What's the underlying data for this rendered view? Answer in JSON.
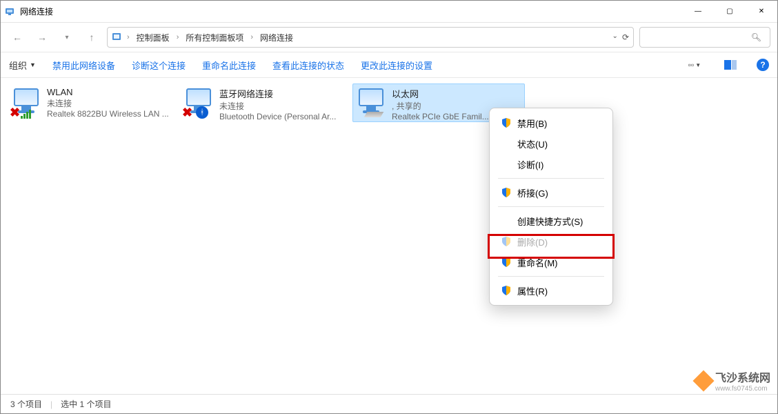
{
  "window": {
    "title": "网络连接"
  },
  "breadcrumbs": {
    "root": "控制面板",
    "all": "所有控制面板项",
    "here": "网络连接"
  },
  "toolbar": {
    "organize": "组织",
    "disable": "禁用此网络设备",
    "diagnose": "诊断这个连接",
    "rename": "重命名此连接",
    "view_status": "查看此连接的状态",
    "change_settings": "更改此连接的设置"
  },
  "items": [
    {
      "name": "WLAN",
      "status": "未连接",
      "device": "Realtek 8822BU Wireless LAN ..."
    },
    {
      "name": "蓝牙网络连接",
      "status": "未连接",
      "device": "Bluetooth Device (Personal Ar..."
    },
    {
      "name": "以太网",
      "status": ", 共享的",
      "device": "Realtek PCIe GbE Famil..."
    }
  ],
  "context_menu": {
    "disable": "禁用(B)",
    "status": "状态(U)",
    "diagnose": "诊断(I)",
    "bridge": "桥接(G)",
    "shortcut": "创建快捷方式(S)",
    "delete": "删除(D)",
    "rename": "重命名(M)",
    "properties": "属性(R)"
  },
  "statusbar": {
    "count": "3 个项目",
    "selected": "选中 1 个项目"
  },
  "watermark": {
    "name": "飞沙系统网",
    "url": "www.fs0745.com"
  }
}
